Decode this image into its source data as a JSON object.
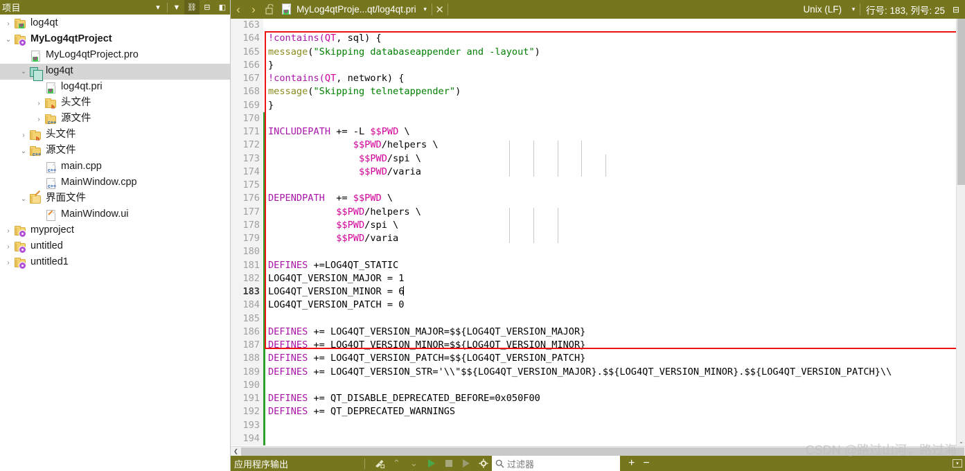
{
  "sidebar": {
    "title": "项目",
    "header_icons": [
      {
        "name": "chevron-down-icon",
        "glyph": "▾"
      },
      {
        "name": "filter-icon",
        "glyph": "▼"
      },
      {
        "name": "link-icon",
        "glyph": "⛓"
      },
      {
        "name": "add-split-icon",
        "glyph": "⊟"
      },
      {
        "name": "close-pane-icon",
        "glyph": "◧"
      }
    ],
    "items": [
      {
        "label": "log4qt",
        "indent": 0,
        "twist": "›",
        "icon": "folder-qt-icon",
        "bold": false,
        "selected": false
      },
      {
        "label": "MyLog4qtProject",
        "indent": 0,
        "twist": "⌄",
        "icon": "folder-pro-icon",
        "bold": true,
        "selected": false
      },
      {
        "label": "MyLog4qtProject.pro",
        "indent": 1,
        "twist": "",
        "icon": "file-qt-icon",
        "bold": false,
        "selected": false
      },
      {
        "label": "log4qt",
        "indent": 1,
        "twist": "⌄",
        "icon": "subproject-icon",
        "bold": false,
        "selected": true
      },
      {
        "label": "log4qt.pri",
        "indent": 2,
        "twist": "",
        "icon": "file-qt-icon",
        "bold": false,
        "selected": false
      },
      {
        "label": "头文件",
        "indent": 2,
        "twist": "›",
        "icon": "folder-h-icon",
        "bold": false,
        "selected": false
      },
      {
        "label": "源文件",
        "indent": 2,
        "twist": "›",
        "icon": "folder-cpp-icon",
        "bold": false,
        "selected": false
      },
      {
        "label": "头文件",
        "indent": 1,
        "twist": "›",
        "icon": "folder-h-icon",
        "bold": false,
        "selected": false
      },
      {
        "label": "源文件",
        "indent": 1,
        "twist": "⌄",
        "icon": "folder-cpp-icon",
        "bold": false,
        "selected": false
      },
      {
        "label": "main.cpp",
        "indent": 2,
        "twist": "",
        "icon": "file-cpp-icon",
        "bold": false,
        "selected": false
      },
      {
        "label": "MainWindow.cpp",
        "indent": 2,
        "twist": "",
        "icon": "file-cpp-icon",
        "bold": false,
        "selected": false
      },
      {
        "label": "界面文件",
        "indent": 1,
        "twist": "⌄",
        "icon": "folder-ui-icon",
        "bold": false,
        "selected": false
      },
      {
        "label": "MainWindow.ui",
        "indent": 2,
        "twist": "",
        "icon": "file-ui-icon",
        "bold": false,
        "selected": false
      },
      {
        "label": "myproject",
        "indent": 0,
        "twist": "›",
        "icon": "folder-pro-icon",
        "bold": false,
        "selected": false
      },
      {
        "label": "untitled",
        "indent": 0,
        "twist": "›",
        "icon": "folder-pro-icon",
        "bold": false,
        "selected": false
      },
      {
        "label": "untitled1",
        "indent": 0,
        "twist": "›",
        "icon": "folder-pro-icon",
        "bold": false,
        "selected": false
      }
    ]
  },
  "tabbar": {
    "back_glyph": "‹",
    "forward_glyph": "›",
    "lock_glyph": "🔓",
    "file_label": "MyLog4qtProje...qt/log4qt.pri",
    "dropdown_glyph": "▾",
    "close_glyph": "✕",
    "eol": "Unix (LF)",
    "eol_dropdown_glyph": "▾",
    "line_col": "行号: 183, 列号: 25",
    "split_glyph": "⊟"
  },
  "editor": {
    "first_line_number": 163,
    "current_line": 183,
    "lines": [
      {
        "n": 163,
        "changed": false,
        "tokens": []
      },
      {
        "n": 164,
        "changed": false,
        "tokens": [
          {
            "t": "!contains(",
            "c": "kw"
          },
          {
            "t": "QT",
            "c": "qt"
          },
          {
            "t": ", sql) {",
            "c": "op"
          }
        ]
      },
      {
        "n": 165,
        "changed": false,
        "tokens": [
          {
            "t": "message",
            "c": "fn"
          },
          {
            "t": "(",
            "c": "op"
          },
          {
            "t": "\"Skipping databaseappender and -layout\"",
            "c": "str"
          },
          {
            "t": ")",
            "c": "op"
          }
        ]
      },
      {
        "n": 166,
        "changed": false,
        "tokens": [
          {
            "t": "}",
            "c": "op"
          }
        ]
      },
      {
        "n": 167,
        "changed": false,
        "tokens": [
          {
            "t": "!contains(",
            "c": "kw"
          },
          {
            "t": "QT",
            "c": "qt"
          },
          {
            "t": ", network) {",
            "c": "op"
          }
        ]
      },
      {
        "n": 168,
        "changed": false,
        "tokens": [
          {
            "t": "message",
            "c": "fn"
          },
          {
            "t": "(",
            "c": "op"
          },
          {
            "t": "\"Skipping telnetappender\"",
            "c": "str"
          },
          {
            "t": ")",
            "c": "op"
          }
        ]
      },
      {
        "n": 169,
        "changed": false,
        "tokens": [
          {
            "t": "}",
            "c": "op"
          }
        ]
      },
      {
        "n": 170,
        "changed": true,
        "tokens": []
      },
      {
        "n": 171,
        "changed": true,
        "tokens": [
          {
            "t": "INCLUDEPATH",
            "c": "kw"
          },
          {
            "t": " += -L ",
            "c": "op"
          },
          {
            "t": "$$PWD",
            "c": "qt"
          },
          {
            "t": " \\",
            "c": "op"
          }
        ]
      },
      {
        "n": 172,
        "changed": true,
        "tokens": [
          {
            "t": "               ",
            "c": "op"
          },
          {
            "t": "$$PWD",
            "c": "qt"
          },
          {
            "t": "/helpers \\",
            "c": "op"
          }
        ]
      },
      {
        "n": 173,
        "changed": true,
        "tokens": [
          {
            "t": "                ",
            "c": "op"
          },
          {
            "t": "$$PWD",
            "c": "qt"
          },
          {
            "t": "/spi \\",
            "c": "op"
          }
        ]
      },
      {
        "n": 174,
        "changed": true,
        "tokens": [
          {
            "t": "                ",
            "c": "op"
          },
          {
            "t": "$$PWD",
            "c": "qt"
          },
          {
            "t": "/varia",
            "c": "op"
          }
        ]
      },
      {
        "n": 175,
        "changed": true,
        "tokens": []
      },
      {
        "n": 176,
        "changed": true,
        "tokens": [
          {
            "t": "DEPENDPATH",
            "c": "kw"
          },
          {
            "t": "  += ",
            "c": "op"
          },
          {
            "t": "$$PWD",
            "c": "qt"
          },
          {
            "t": " \\",
            "c": "op"
          }
        ]
      },
      {
        "n": 177,
        "changed": true,
        "tokens": [
          {
            "t": "            ",
            "c": "op"
          },
          {
            "t": "$$PWD",
            "c": "qt"
          },
          {
            "t": "/helpers \\",
            "c": "op"
          }
        ]
      },
      {
        "n": 178,
        "changed": true,
        "tokens": [
          {
            "t": "            ",
            "c": "op"
          },
          {
            "t": "$$PWD",
            "c": "qt"
          },
          {
            "t": "/spi \\",
            "c": "op"
          }
        ]
      },
      {
        "n": 179,
        "changed": true,
        "tokens": [
          {
            "t": "            ",
            "c": "op"
          },
          {
            "t": "$$PWD",
            "c": "qt"
          },
          {
            "t": "/varia",
            "c": "op"
          }
        ]
      },
      {
        "n": 180,
        "changed": true,
        "tokens": []
      },
      {
        "n": 181,
        "changed": true,
        "tokens": [
          {
            "t": "DEFINES",
            "c": "kw"
          },
          {
            "t": " +=LOG4QT_STATIC",
            "c": "op"
          }
        ]
      },
      {
        "n": 182,
        "changed": true,
        "tokens": [
          {
            "t": "LOG4QT_VERSION_MAJOR = 1",
            "c": "op"
          }
        ]
      },
      {
        "n": 183,
        "changed": true,
        "tokens": [
          {
            "t": "LOG4QT_VERSION_MINOR = 6",
            "c": "op"
          }
        ],
        "caret": true
      },
      {
        "n": 184,
        "changed": true,
        "tokens": [
          {
            "t": "LOG4QT_VERSION_PATCH = 0",
            "c": "op"
          }
        ]
      },
      {
        "n": 185,
        "changed": true,
        "tokens": []
      },
      {
        "n": 186,
        "changed": true,
        "tokens": [
          {
            "t": "DEFINES",
            "c": "kw"
          },
          {
            "t": " += LOG4QT_VERSION_MAJOR=$${LOG4QT_VERSION_MAJOR}",
            "c": "op"
          }
        ]
      },
      {
        "n": 187,
        "changed": true,
        "tokens": [
          {
            "t": "DEFINES",
            "c": "kw"
          },
          {
            "t": " += LOG4QT_VERSION_MINOR=$${LOG4QT_VERSION_MINOR}",
            "c": "op"
          }
        ]
      },
      {
        "n": 188,
        "changed": true,
        "tokens": [
          {
            "t": "DEFINES",
            "c": "kw"
          },
          {
            "t": " += LOG4QT_VERSION_PATCH=$${LOG4QT_VERSION_PATCH}",
            "c": "op"
          }
        ]
      },
      {
        "n": 189,
        "changed": true,
        "tokens": [
          {
            "t": "DEFINES",
            "c": "kw"
          },
          {
            "t": " += LOG4QT_VERSION_STR='\\\\\"$${LOG4QT_VERSION_MAJOR}.$${LOG4QT_VERSION_MINOR}.$${LOG4QT_VERSION_PATCH}\\\\",
            "c": "op"
          }
        ]
      },
      {
        "n": 190,
        "changed": true,
        "tokens": []
      },
      {
        "n": 191,
        "changed": true,
        "tokens": [
          {
            "t": "DEFINES",
            "c": "kw"
          },
          {
            "t": " += QT_DISABLE_DEPRECATED_BEFORE=0x050F00",
            "c": "op"
          }
        ]
      },
      {
        "n": 192,
        "changed": true,
        "tokens": [
          {
            "t": "DEFINES",
            "c": "kw"
          },
          {
            "t": " += QT_DEPRECATED_WARNINGS",
            "c": "op"
          }
        ]
      },
      {
        "n": 193,
        "changed": true,
        "tokens": []
      },
      {
        "n": 194,
        "changed": true,
        "tokens": []
      }
    ],
    "scrollbars": {
      "vertical_down_glyph": "⌄",
      "horizontal_left_glyph": "❮"
    }
  },
  "output_bar": {
    "title": "应用程序输出",
    "icons": [
      {
        "name": "clear-output-icon",
        "glyph": "🗑"
      },
      {
        "name": "prev-item-icon",
        "glyph": "⌃"
      },
      {
        "name": "next-item-icon",
        "glyph": "⌄"
      },
      {
        "name": "run-icon",
        "glyph": "▶"
      },
      {
        "name": "stop-icon",
        "glyph": "■"
      },
      {
        "name": "rerun-icon",
        "glyph": "▶"
      },
      {
        "name": "settings-gear-icon",
        "glyph": "⚙"
      }
    ],
    "filter_placeholder": "过滤器",
    "zoom_in": "+",
    "zoom_out": "−",
    "collapse_glyph": "▾"
  },
  "watermark": {
    "text": "CSDN @路过山河，路过海"
  },
  "colors": {
    "chrome": "#76761e",
    "accent_keyword": "#a914a9",
    "accent_string": "#008000",
    "accent_function": "#8b8b1e",
    "accent_qt_var": "#d2009a",
    "annotation_red": "#ee1111",
    "change_marker_green": "#2ea02e",
    "selection_gray": "#d6d6d6"
  }
}
